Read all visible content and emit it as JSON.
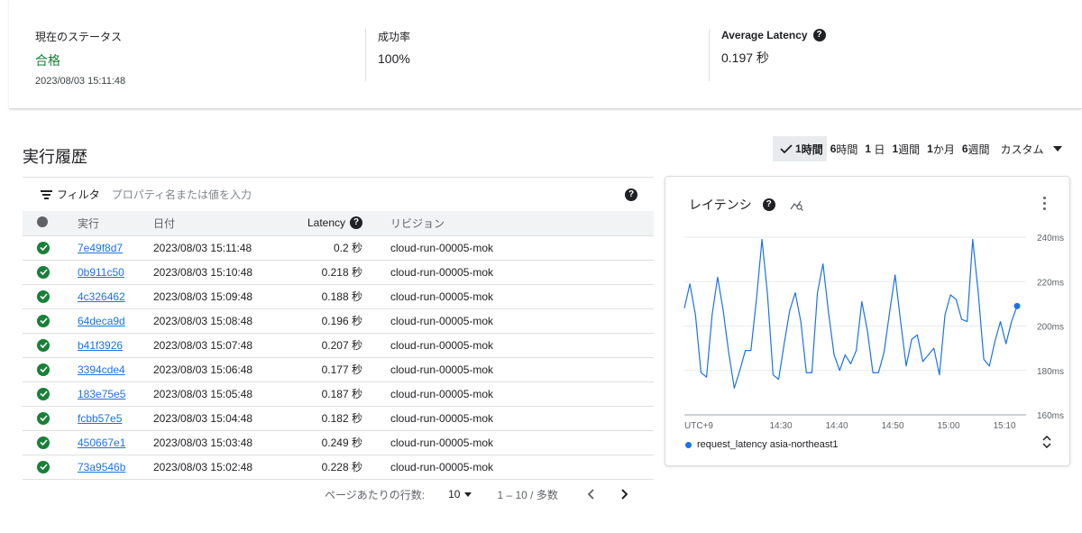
{
  "status": {
    "current_label": "現在のステータス",
    "current_value": "合格",
    "current_time": "2023/08/03 15:11:48",
    "success_label": "成功率",
    "success_value": "100%",
    "latency_label": "Average Latency",
    "latency_value": "0.197 秒"
  },
  "history": {
    "title": "実行履歴",
    "time_ranges": [
      {
        "num": "1",
        "unit": "時間",
        "selected": true
      },
      {
        "num": "6",
        "unit": "時間"
      },
      {
        "num": "1",
        "unit": " 日"
      },
      {
        "num": "1",
        "unit": "週間"
      },
      {
        "num": "1",
        "unit": "か月"
      },
      {
        "num": "6",
        "unit": "週間"
      }
    ],
    "custom_label": "カスタム",
    "filter_label": "フィルタ",
    "filter_placeholder": "プロパティ名または値を入力",
    "columns": {
      "run": "実行",
      "date": "日付",
      "latency": "Latency",
      "revision": "リビジョン"
    },
    "rows": [
      {
        "id": "7e49f8d7",
        "date": "2023/08/03 15:11:48",
        "latency": "0.2 秒",
        "revision": "cloud-run-00005-mok"
      },
      {
        "id": "0b911c50",
        "date": "2023/08/03 15:10:48",
        "latency": "0.218 秒",
        "revision": "cloud-run-00005-mok"
      },
      {
        "id": "4c326462",
        "date": "2023/08/03 15:09:48",
        "latency": "0.188 秒",
        "revision": "cloud-run-00005-mok"
      },
      {
        "id": "64deca9d",
        "date": "2023/08/03 15:08:48",
        "latency": "0.196 秒",
        "revision": "cloud-run-00005-mok"
      },
      {
        "id": "b41f3926",
        "date": "2023/08/03 15:07:48",
        "latency": "0.207 秒",
        "revision": "cloud-run-00005-mok"
      },
      {
        "id": "3394cde4",
        "date": "2023/08/03 15:06:48",
        "latency": "0.177 秒",
        "revision": "cloud-run-00005-mok"
      },
      {
        "id": "183e75e5",
        "date": "2023/08/03 15:05:48",
        "latency": "0.187 秒",
        "revision": "cloud-run-00005-mok"
      },
      {
        "id": "fcbb57e5",
        "date": "2023/08/03 15:04:48",
        "latency": "0.182 秒",
        "revision": "cloud-run-00005-mok"
      },
      {
        "id": "450667e1",
        "date": "2023/08/03 15:03:48",
        "latency": "0.249 秒",
        "revision": "cloud-run-00005-mok"
      },
      {
        "id": "73a9546b",
        "date": "2023/08/03 15:02:48",
        "latency": "0.228 秒",
        "revision": "cloud-run-00005-mok"
      }
    ],
    "pager": {
      "rows_label": "ページあたりの行数:",
      "rows_value": "10",
      "range": "1 – 10 / 多数"
    }
  },
  "chart_data": {
    "type": "line",
    "title": "レイテンシ",
    "timezone_label": "UTC+9",
    "x_ticks": [
      "14:30",
      "14:40",
      "14:50",
      "15:00",
      "15:10"
    ],
    "y_ticks": [
      "160ms",
      "180ms",
      "200ms",
      "220ms",
      "240ms"
    ],
    "ylim": [
      160,
      240
    ],
    "series": [
      {
        "name": "request_latency asia-northeast1",
        "color": "#1a73e8",
        "values": [
          208,
          219,
          205,
          179,
          177,
          205,
          222,
          207,
          188,
          172,
          180,
          189,
          189,
          212,
          239,
          214,
          178,
          176,
          192,
          207,
          215,
          202,
          179,
          179,
          215,
          228,
          206,
          187,
          180,
          187,
          183,
          189,
          211,
          198,
          179,
          179,
          188,
          206,
          223,
          202,
          182,
          194,
          196,
          184,
          187,
          190,
          178,
          205,
          214,
          212,
          203,
          202,
          239,
          215,
          185,
          182,
          193,
          202,
          192,
          202,
          209
        ]
      }
    ],
    "grid": true,
    "legend": "bottom"
  }
}
